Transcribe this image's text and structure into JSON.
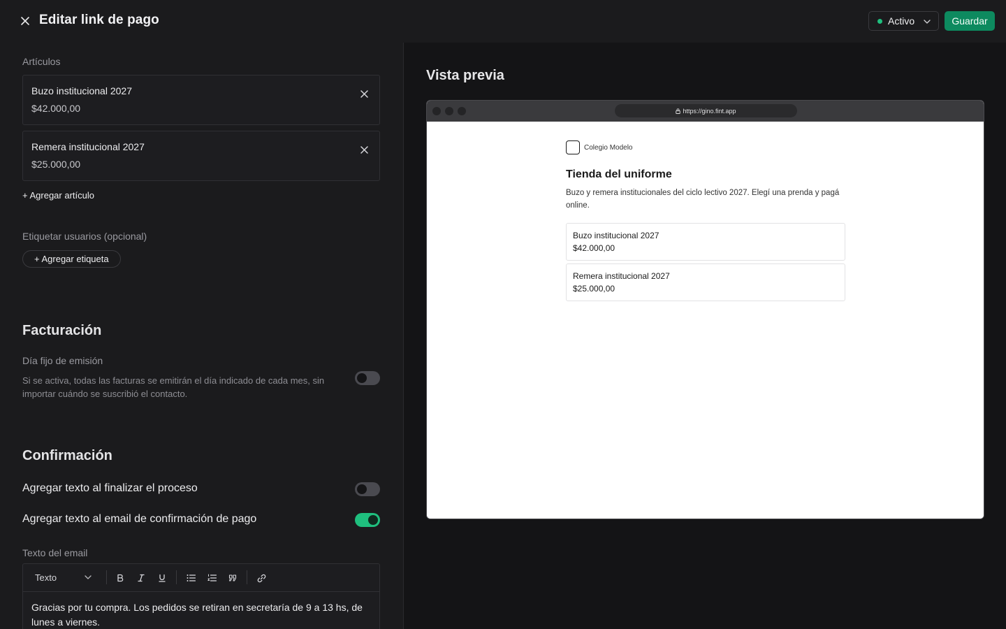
{
  "header": {
    "title": "Editar link de pago",
    "status": "Activo",
    "save_label": "Guardar"
  },
  "articles": {
    "label": "Artículos",
    "items": [
      {
        "name": "Buzo institucional 2027",
        "price": "$42.000,00"
      },
      {
        "name": "Remera institucional 2027",
        "price": "$25.000,00"
      }
    ],
    "add_label": "+ Agregar artículo"
  },
  "tags": {
    "label": "Etiquetar usuarios (opcional)",
    "add_label": "+ Agregar etiqueta"
  },
  "billing": {
    "title": "Facturación",
    "fixed_day_label": "Día fijo de emisión",
    "fixed_day_desc": "Si se activa, todas las facturas se emitirán el día indicado de cada mes, sin importar cuándo se suscribió el contacto.",
    "fixed_day_enabled": false
  },
  "confirmation": {
    "title": "Confirmación",
    "options": [
      {
        "label": "Agregar texto al finalizar el proceso",
        "enabled": false
      },
      {
        "label": "Agregar texto al email de confirmación de pago",
        "enabled": true
      }
    ],
    "email_text_label": "Texto del email",
    "editor": {
      "format": "Texto",
      "content": "Gracias por tu compra. Los pedidos se retiran en secretaría de 9 a 13 hs, de lunes a viernes."
    }
  },
  "preview": {
    "title": "Vista previa",
    "url": "https://gino.fint.app",
    "org_name": "Colegio Modelo",
    "store_title": "Tienda del uniforme",
    "store_desc": "Buzo y remera institucionales del ciclo lectivo 2027. Elegí una prenda y pagá online.",
    "products": [
      {
        "name": "Buzo institucional 2027",
        "price": "$42.000,00"
      },
      {
        "name": "Remera institucional 2027",
        "price": "$25.000,00"
      }
    ]
  },
  "colors": {
    "accent": "#0d8a5f",
    "toggle_on": "#1fbf7e",
    "background": "#1b1b1d"
  }
}
